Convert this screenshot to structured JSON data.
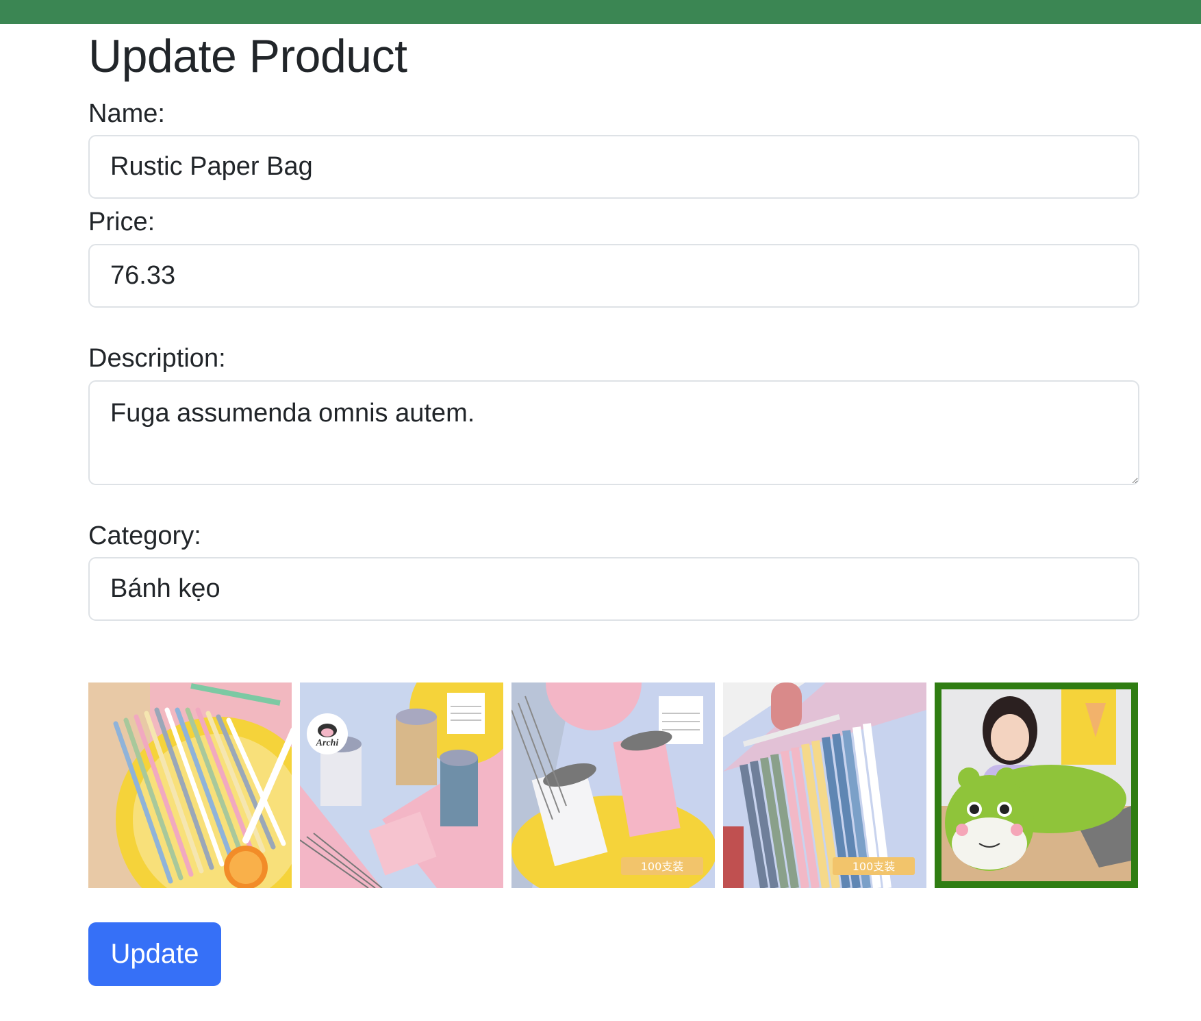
{
  "page": {
    "title": "Update Product"
  },
  "form": {
    "name_label": "Name:",
    "name_value": "Rustic Paper Bag",
    "price_label": "Price:",
    "price_value": "76.33",
    "description_label": "Description:",
    "description_value": "Fuga assumenda omnis autem.",
    "category_label": "Category:",
    "category_value": "Bánh kẹo",
    "submit_label": "Update"
  },
  "gallery": {
    "images": [
      {
        "subject": "pen refills on yellow plate with orange slice",
        "selected": false
      },
      {
        "subject": "bundles of pen refills with Archi logo",
        "logo_text": "Archi",
        "selected": false
      },
      {
        "subject": "white and pink pen refill bundles on yellow plate",
        "badge_text": "100支装",
        "selected": false
      },
      {
        "subject": "rows of colored pen refills",
        "badge_text": "100支装",
        "selected": false
      },
      {
        "subject": "girl with green frog plush pillow",
        "selected": true
      }
    ],
    "selected_border_color": "#2f7d12"
  },
  "colors": {
    "topbar": "#3b8653",
    "primary_button": "#3670f7"
  }
}
